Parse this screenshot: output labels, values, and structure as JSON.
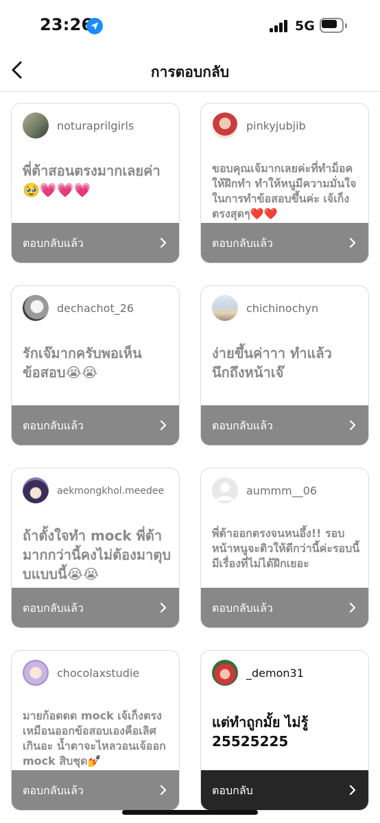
{
  "status_bar": {
    "time": "23:26",
    "network": "5G",
    "location_icon": "location-arrow-icon",
    "signal_icon": "cellular-signal-icon",
    "battery_icon": "battery-icon"
  },
  "header": {
    "back_icon": "chevron-left-icon",
    "title": "การตอบกลับ"
  },
  "cards": [
    {
      "username": "noturaprilgirls",
      "message": "พี่ต้าสอนตรงมากเลยค่า🥹💗💗💗",
      "action": "ตอบกลับแล้ว",
      "replied": true
    },
    {
      "username": "pinkyjubjib",
      "message": "ขอบคุณเจ้มากเลยค่ะที่ทำม็อคให้ฝึกทำ ทำให้หนูมีความมั่นใจในการทำข้อสอบขึ้นค่ะ เจ้เก็งตรงสุดๆ❤️❤️",
      "action": "ตอบกลับแล้ว",
      "replied": true
    },
    {
      "username": "dechachot_26",
      "message": "รักเจ๊มากครับพอเห็นข้อสอบ😭😭",
      "action": "ตอบกลับแล้ว",
      "replied": true
    },
    {
      "username": "chichinochyn",
      "message": "ง่ายขึ้นค่าาา ทำแล้วนึกถึงหน้าเจ๊",
      "action": "ตอบกลับแล้ว",
      "replied": true
    },
    {
      "username": "aekmongkhol.meedee",
      "message": "ถ้าตั้งใจทำ mock พี่ต้ามากกว่านี้คงไม่ต้องมาตุบบแบบนี้😭😭",
      "action": "ตอบกลับแล้ว",
      "replied": true
    },
    {
      "username": "aummm__06",
      "message": "พี่ต้าออกตรงจนหนอึ้ง!! รอบหน้าหนูจะติวให้ดีกว่านี้ค่ะรอบนี้มีเรื่องที่ไม่ได้ฝึกเยอะ",
      "action": "ตอบกลับแล้ว",
      "replied": true
    },
    {
      "username": "chocolaxstudie",
      "message": "มายก้อดดด mock เจ้เก็งตรงเหมือนออกข้อสอบเองคือเลิศเกินอะ น้ำตาจะไหลวอนเจ้ออก mock สิบชุด💅",
      "action": "ตอบกลับแล้ว",
      "replied": true
    },
    {
      "username": "_demon31",
      "message": "แต่ทำถูกมั้ย ไม่รู้ 25525225",
      "action": "ตอบกลับ",
      "replied": false
    }
  ]
}
